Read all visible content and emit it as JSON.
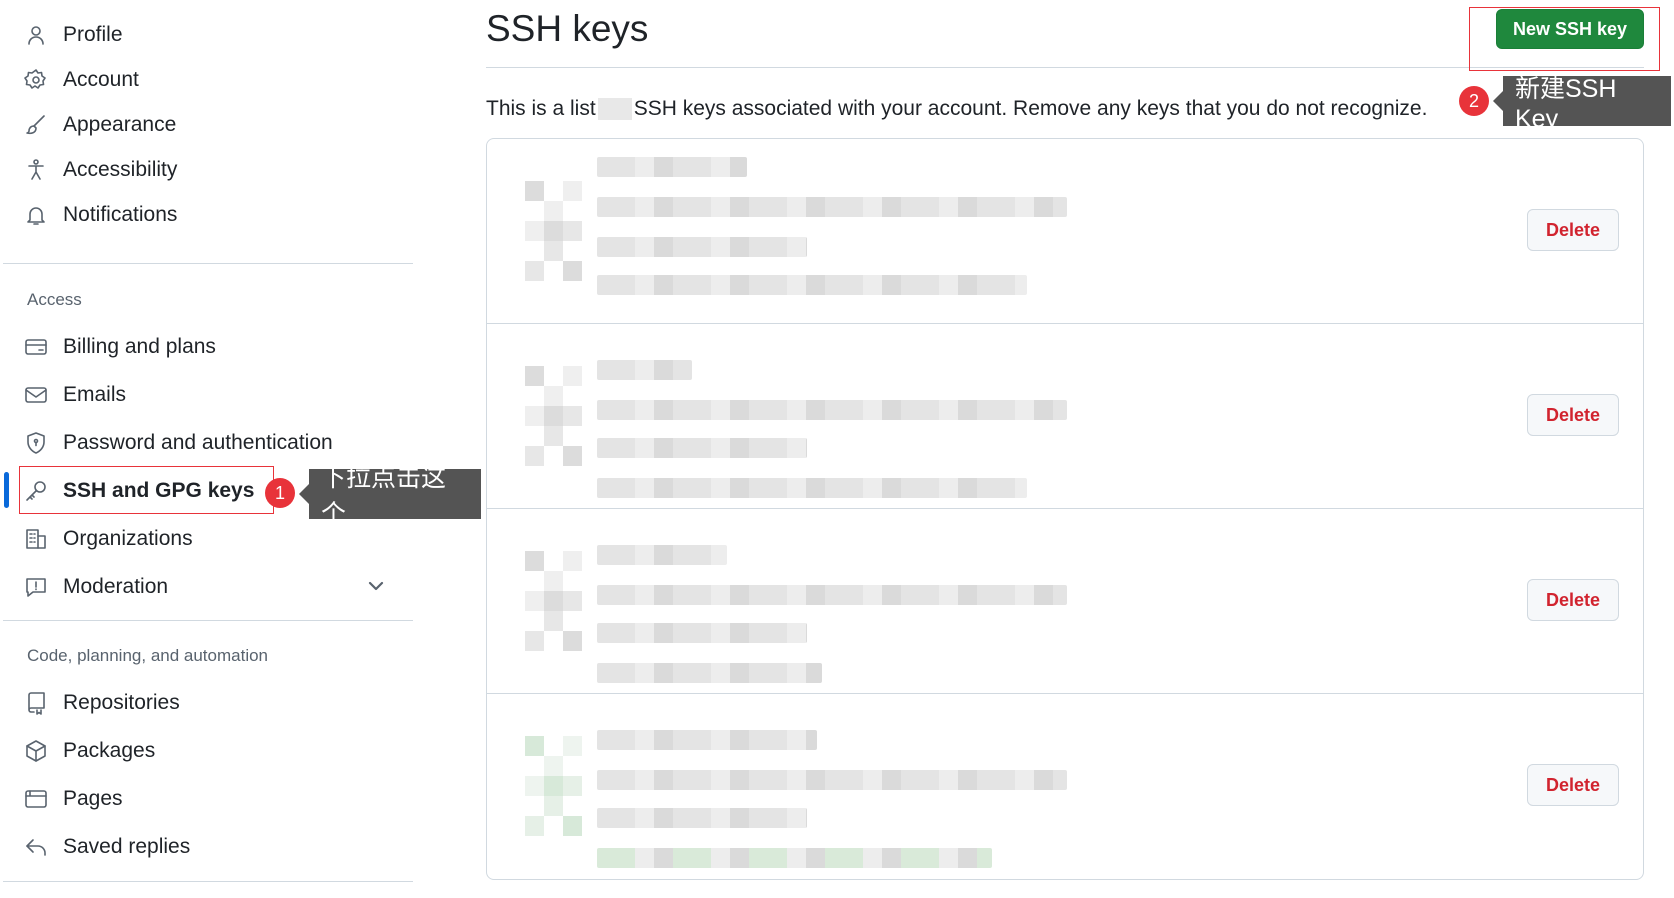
{
  "sidebar": {
    "top_items": [
      {
        "label": "Profile",
        "icon": "person-icon"
      },
      {
        "label": "Account",
        "icon": "gear-icon"
      },
      {
        "label": "Appearance",
        "icon": "paintbrush-icon"
      },
      {
        "label": "Accessibility",
        "icon": "accessibility-icon"
      },
      {
        "label": "Notifications",
        "icon": "bell-icon"
      }
    ],
    "access_title": "Access",
    "access_items": [
      {
        "label": "Billing and plans",
        "icon": "credit-card-icon"
      },
      {
        "label": "Emails",
        "icon": "mail-icon"
      },
      {
        "label": "Password and authentication",
        "icon": "shield-icon"
      },
      {
        "label": "SSH and GPG keys",
        "icon": "key-icon",
        "active": true
      },
      {
        "label": "Organizations",
        "icon": "organization-icon"
      },
      {
        "label": "Moderation",
        "icon": "report-icon",
        "expandable": true
      }
    ],
    "code_title": "Code, planning, and automation",
    "code_items": [
      {
        "label": "Repositories",
        "icon": "repo-icon"
      },
      {
        "label": "Packages",
        "icon": "package-icon"
      },
      {
        "label": "Pages",
        "icon": "browser-icon"
      },
      {
        "label": "Saved replies",
        "icon": "reply-icon"
      }
    ]
  },
  "annotations": {
    "step1_number": "1",
    "step1_text": "下拉点击这个",
    "step2_number": "2",
    "step2_text": "新建SSH Key"
  },
  "main": {
    "title": "SSH keys",
    "new_button_label": "New SSH key",
    "intro_before": "This is a list",
    "intro_after": "SSH keys associated with your account. Remove any keys that you do not recognize.",
    "delete_label": "Delete",
    "key_count": 4
  },
  "colors": {
    "primary_button": "#1f883d",
    "danger_text": "#d1242f",
    "active_indicator": "#0969da",
    "annotation_red": "#e8333a",
    "tooltip_bg": "#545454"
  }
}
